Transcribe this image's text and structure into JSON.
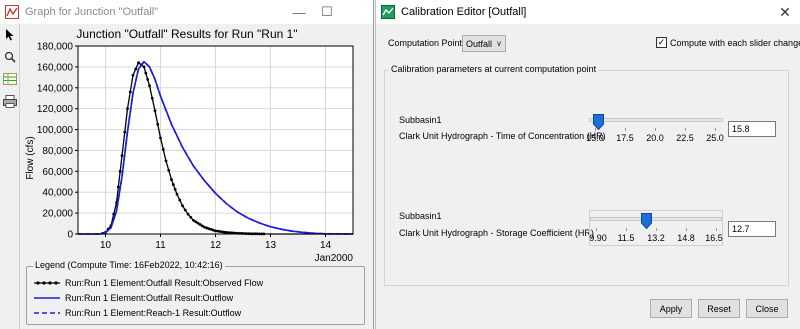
{
  "graph_window": {
    "title": "Graph for Junction \"Outfall\"",
    "tools": [
      "pointer-icon",
      "zoom-icon",
      "table-icon",
      "print-icon"
    ]
  },
  "chart_data": {
    "type": "line",
    "title": "Junction \"Outfall\" Results for Run \"Run 1\"",
    "ylabel": "Flow (cfs)",
    "xlabel": "Jan2000",
    "ylim": [
      0,
      180000
    ],
    "xlim": [
      9.5,
      14.5
    ],
    "yticks": [
      "0",
      "20,000",
      "40,000",
      "60,000",
      "80,000",
      "100,000",
      "120,000",
      "140,000",
      "160,000",
      "180,000"
    ],
    "yticks_values": [
      0,
      20000,
      40000,
      60000,
      80000,
      100000,
      120000,
      140000,
      160000,
      180000
    ],
    "xticks": [
      "10",
      "11",
      "12",
      "13",
      "14"
    ],
    "xticks_values": [
      10,
      11,
      12,
      13,
      14
    ],
    "grid": true,
    "series": [
      {
        "name": "Run:Run 1 Element:Outfall Result:Observed Flow",
        "color": "#000000",
        "marker": "dot",
        "x": [
          9.5,
          9.9,
          10.0,
          10.1,
          10.2,
          10.3,
          10.4,
          10.5,
          10.6,
          10.7,
          10.8,
          10.9,
          11.0,
          11.1,
          11.2,
          11.3,
          11.4,
          11.5,
          11.6,
          11.8,
          12.0,
          12.2,
          12.4,
          12.6,
          13.0,
          13.5,
          14.5
        ],
        "y": [
          0,
          0,
          1500,
          8000,
          30000,
          75000,
          120000,
          152000,
          164000,
          160000,
          142000,
          118000,
          92000,
          70000,
          52000,
          38000,
          27000,
          19000,
          13000,
          6500,
          3000,
          1500,
          700,
          300,
          0,
          0,
          0
        ]
      },
      {
        "name": "Run:Run 1 Element:Outfall Result:Outflow",
        "color": "#1a1adc",
        "marker": "none",
        "x": [
          9.5,
          9.9,
          10.0,
          10.1,
          10.2,
          10.3,
          10.4,
          10.5,
          10.6,
          10.7,
          10.8,
          10.9,
          11.0,
          11.2,
          11.4,
          11.6,
          11.8,
          12.0,
          12.2,
          12.4,
          12.6,
          12.8,
          13.0,
          13.2,
          13.4,
          13.6,
          13.8,
          14.0,
          14.5
        ],
        "y": [
          0,
          0,
          1200,
          6000,
          22000,
          55000,
          98000,
          135000,
          158000,
          165000,
          160000,
          148000,
          132000,
          105000,
          83000,
          65000,
          51000,
          39000,
          29000,
          21000,
          15000,
          10500,
          7000,
          4500,
          2700,
          1500,
          700,
          200,
          0
        ]
      },
      {
        "name": "Run:Run 1 Element:Reach-1 Result:Outflow",
        "color": "#1a1adc",
        "marker": "none",
        "dashed": true,
        "x": [
          9.5,
          9.9,
          10.0,
          10.1,
          10.2,
          10.3,
          10.4,
          10.5,
          10.6,
          10.7,
          10.8,
          10.9,
          11.0,
          11.2,
          11.4,
          11.6,
          11.8,
          12.0,
          12.2,
          12.4,
          12.6,
          12.8,
          13.0,
          13.2,
          13.4,
          13.6,
          13.8,
          14.0,
          14.5
        ],
        "y": [
          0,
          0,
          1200,
          6000,
          22000,
          55000,
          98000,
          135000,
          158000,
          165000,
          160000,
          148000,
          132000,
          105000,
          83000,
          65000,
          51000,
          39000,
          29000,
          21000,
          15000,
          10500,
          7000,
          4500,
          2700,
          1500,
          700,
          200,
          0
        ]
      }
    ]
  },
  "legend": {
    "title": "Legend (Compute Time: 16Feb2022, 10:42:16)",
    "items": [
      "Run:Run 1 Element:Outfall Result:Observed Flow",
      "Run:Run 1 Element:Outfall Result:Outflow",
      "Run:Run 1 Element:Reach-1 Result:Outflow"
    ]
  },
  "calibration_window": {
    "title": "Calibration Editor [Outfall]",
    "computation_point_label": "Computation Point:",
    "computation_point_value": "Outfall",
    "compute_checkbox_label": "Compute with each slider change",
    "compute_checkbox_checked": true,
    "group_title": "Calibration parameters at current computation point",
    "params": [
      {
        "subbasin": "Subbasin1",
        "name": "Clark Unit Hydrograph - Time of Concentration (HR)",
        "value": "15.8",
        "min": 15.0,
        "max": 25.0,
        "current": 15.3,
        "tick_labels": [
          "15.0",
          "17.5",
          "20.0",
          "22.5",
          "25.0"
        ]
      },
      {
        "subbasin": "Subbasin1",
        "name": "Clark Unit Hydrograph - Storage Coefficient (HR)",
        "value": "12.7",
        "min": 9.9,
        "max": 16.5,
        "current": 12.7,
        "tick_labels": [
          "9.90",
          "11.5",
          "13.2",
          "14.8",
          "16.5"
        ]
      }
    ],
    "buttons": {
      "apply": "Apply",
      "reset": "Reset",
      "close": "Close"
    }
  }
}
